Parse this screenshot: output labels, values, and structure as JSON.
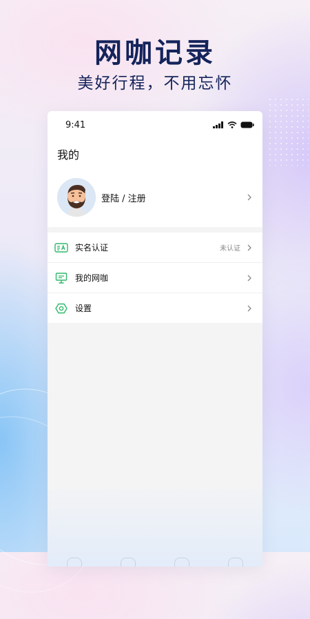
{
  "headline": "网咖记录",
  "subline": "美好行程，不用忘怀",
  "status_bar": {
    "time": "9:41"
  },
  "page": {
    "title": "我的"
  },
  "profile": {
    "login_label": "登陆 / 注册"
  },
  "menu": {
    "items": [
      {
        "label": "实名认证",
        "status": "未认证",
        "icon": "id-card-icon"
      },
      {
        "label": "我的网咖",
        "status": "",
        "icon": "monitor-icon"
      },
      {
        "label": "设置",
        "status": "",
        "icon": "settings-hexagon-icon"
      }
    ]
  },
  "colors": {
    "accent_green": "#2fb86a",
    "headline_navy": "#14235a"
  }
}
